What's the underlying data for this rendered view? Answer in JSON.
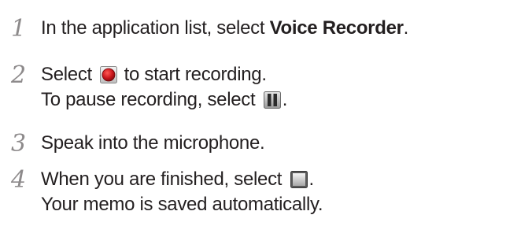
{
  "steps": [
    {
      "number": "1",
      "lines": [
        {
          "before": "In the application list, select ",
          "bold": "Voice Recorder",
          "after": "."
        }
      ]
    },
    {
      "number": "2",
      "lines": [
        {
          "before": "Select ",
          "icon": "record-button-icon",
          "after": " to start recording."
        },
        {
          "before": "To pause recording, select ",
          "icon": "pause-button-icon",
          "after": "."
        }
      ]
    },
    {
      "number": "3",
      "lines": [
        {
          "text": "Speak into the microphone."
        }
      ]
    },
    {
      "number": "4",
      "lines": [
        {
          "before": "When you are finished, select ",
          "icon": "stop-button-icon",
          "after": "."
        },
        {
          "text": "Your memo is saved automatically."
        }
      ]
    }
  ],
  "colors": {
    "text": "#231f20",
    "step_number": "#8d8a8b",
    "record_red": "#c8151b"
  }
}
